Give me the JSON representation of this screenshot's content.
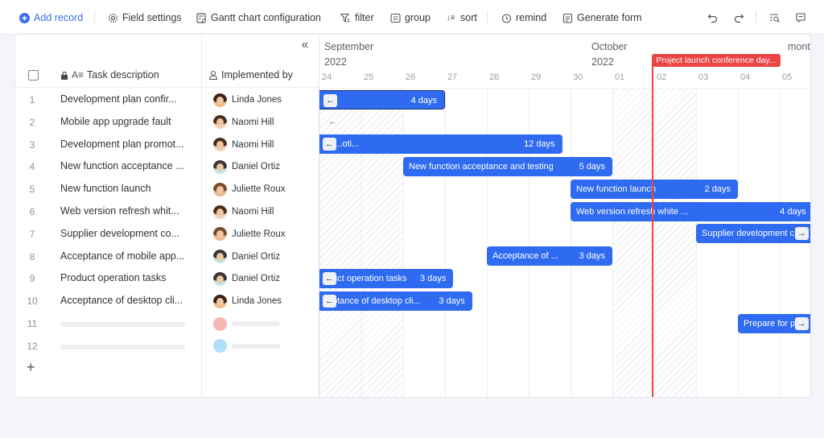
{
  "toolbar": {
    "add_record": "Add record",
    "field_settings": "Field settings",
    "gantt_config": "Gantt chart configuration",
    "filter": "filter",
    "group": "group",
    "sort": "sort",
    "remind": "remind",
    "generate_form": "Generate form",
    "accent": "#3a6df0"
  },
  "table": {
    "headers": {
      "task": "Task description",
      "implemented_by": "Implemented by"
    },
    "rows": [
      {
        "num": "1",
        "task": "Development plan confir...",
        "person": "Linda Jones",
        "avatar": "linda"
      },
      {
        "num": "2",
        "task": "Mobile app upgrade fault",
        "person": "Naomi Hill",
        "avatar": "naomi"
      },
      {
        "num": "3",
        "task": "Development plan promot...",
        "person": "Naomi Hill",
        "avatar": "naomi"
      },
      {
        "num": "4",
        "task": "New function acceptance ...",
        "person": "Daniel Ortiz",
        "avatar": "daniel"
      },
      {
        "num": "5",
        "task": "New function launch",
        "person": "Juliette Roux",
        "avatar": "juliette"
      },
      {
        "num": "6",
        "task": "Web version refresh whit...",
        "person": "Naomi Hill",
        "avatar": "naomi"
      },
      {
        "num": "7",
        "task": "Supplier development co...",
        "person": "Juliette Roux",
        "avatar": "juliette"
      },
      {
        "num": "8",
        "task": "Acceptance of mobile app...",
        "person": "Daniel Ortiz",
        "avatar": "daniel"
      },
      {
        "num": "9",
        "task": "Product operation tasks",
        "person": "Daniel Ortiz",
        "avatar": "daniel"
      },
      {
        "num": "10",
        "task": "Acceptance of desktop cli...",
        "person": "Linda Jones",
        "avatar": "linda"
      },
      {
        "num": "11",
        "task": "",
        "person": "",
        "avatar": "placeholder-pink"
      },
      {
        "num": "12",
        "task": "",
        "person": "",
        "avatar": "placeholder-blue"
      }
    ],
    "add_row_symbol": "+"
  },
  "gantt": {
    "months": [
      {
        "name": "September",
        "year": "2022"
      },
      {
        "name": "October",
        "year": "2022"
      },
      {
        "name": "mont",
        "year": ""
      }
    ],
    "days": [
      "24",
      "25",
      "26",
      "27",
      "28",
      "29",
      "30",
      "01",
      "02",
      "03",
      "04",
      "05"
    ],
    "weekend_day_indices": [
      0,
      1,
      7,
      8
    ],
    "today_day_offset": 7.95,
    "milestone": {
      "label": "Project launch conference day...",
      "color": "#ea4444"
    },
    "bar_color": "#2f6bf1",
    "bars": [
      {
        "row": 0,
        "start": 0,
        "end": 3.0,
        "label": "",
        "duration": "4 days",
        "arrow": "left",
        "selected": true
      },
      {
        "row": 2,
        "start": 0,
        "end": 5.8,
        "label": "or...oti...",
        "duration": "12 days",
        "arrow": "left"
      },
      {
        "row": 3,
        "start": 2.0,
        "end": 7.0,
        "label": "New function acceptance and testing",
        "duration": "5 days"
      },
      {
        "row": 4,
        "start": 6.0,
        "end": 10.0,
        "label": "New function launch",
        "duration": "2 days"
      },
      {
        "row": 5,
        "start": 6.0,
        "end": 11.8,
        "label": "Web version refresh white ...",
        "duration": "4 days"
      },
      {
        "row": 6,
        "start": 9.0,
        "end": 11.8,
        "label": "Supplier development c",
        "duration": "",
        "arrow": "right"
      },
      {
        "row": 7,
        "start": 4.0,
        "end": 7.0,
        "label": "Acceptance of ...",
        "duration": "3 days"
      },
      {
        "row": 8,
        "start": 0,
        "end": 3.2,
        "label": "duct operation tasks",
        "duration": "3 days",
        "arrow": "left"
      },
      {
        "row": 9,
        "start": 0,
        "end": 3.65,
        "label": "eptance of desktop cli...",
        "duration": "3 days",
        "arrow": "left"
      },
      {
        "row": 10,
        "start": 10.0,
        "end": 11.8,
        "label": "Prepare for p",
        "duration": "",
        "arrow": "right"
      }
    ],
    "ghost_arrow_row": 1
  }
}
